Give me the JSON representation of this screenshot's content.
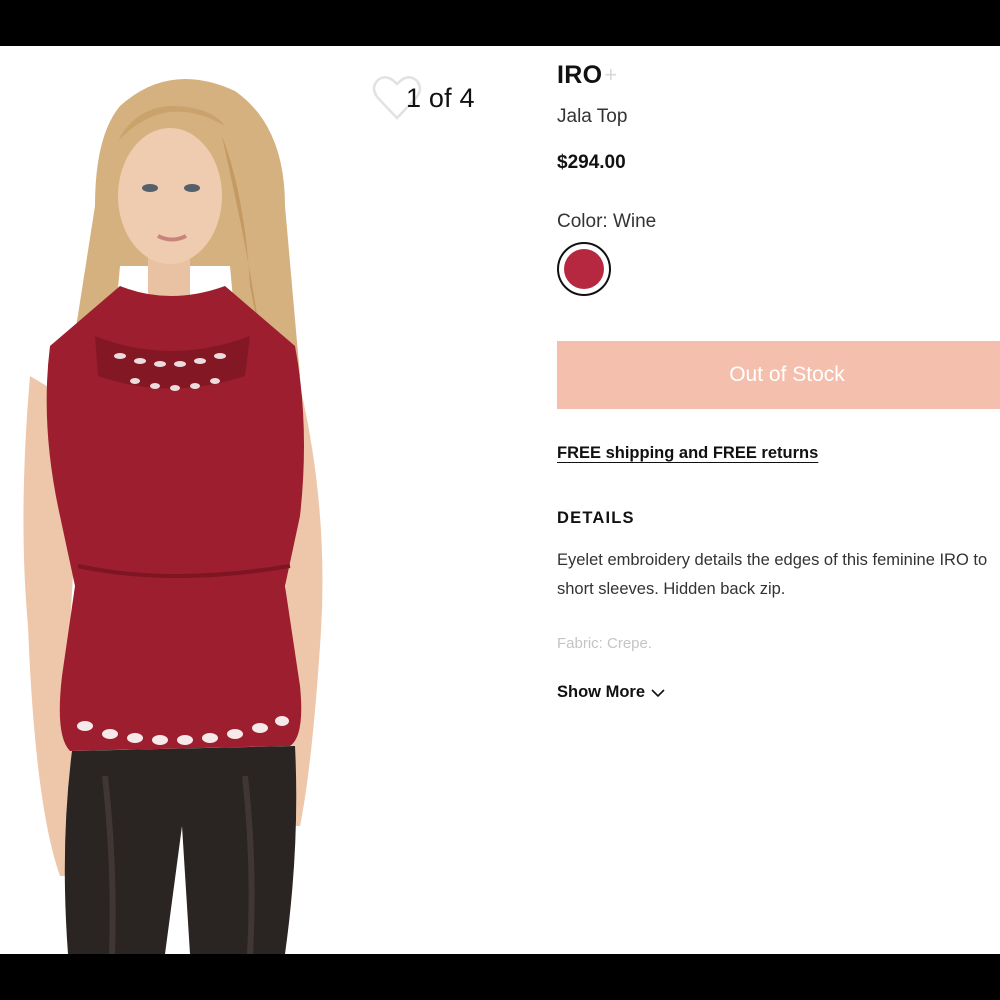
{
  "gallery": {
    "counter": "1 of 4",
    "icons": {
      "favorite": "heart-outline-icon"
    }
  },
  "product": {
    "brand": "IRO",
    "brand_suffix": "+",
    "name": "Jala Top",
    "price": "$294.00",
    "color_label": "Color: Wine",
    "swatch_color": "#b5283f",
    "cta_label": "Out of Stock",
    "cta_color": "#f5bfae",
    "shipping_link": "FREE shipping and FREE returns",
    "details_heading": "DETAILS",
    "description_lines": [
      "Eyelet embroidery details the edges of this feminine IRO to",
      "short sleeves. Hidden back zip."
    ],
    "fabric": "Fabric: Crepe.",
    "show_more": "Show More"
  }
}
